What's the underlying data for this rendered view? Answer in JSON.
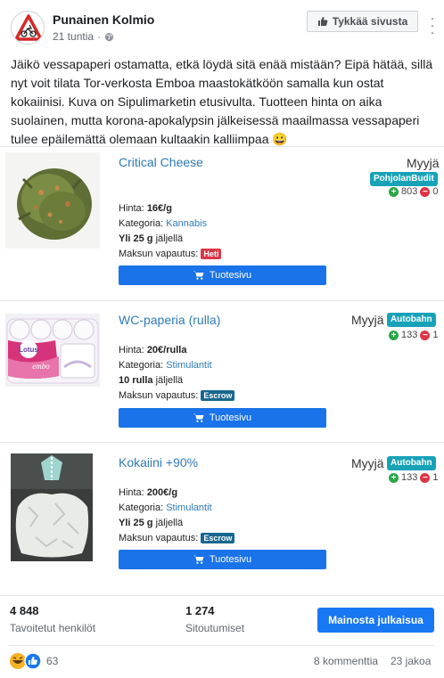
{
  "header": {
    "page_name": "Punainen Kolmio",
    "time": "21 tuntia",
    "like_page_label": "Tykkää sivusta"
  },
  "post": {
    "text": "Jäikö vessapaperi ostamatta, etkä löydä sitä enää mistään? Eipä hätää, sillä nyt voit tilata Tor-verkosta Emboa maastokätköön samalla kun ostat kokaiinisi. Kuva on Sipulimarketin etusivulta. Tuotteen hinta on aika suolainen, mutta korona-apokalypsin jälkeisessä maailmassa vessapaperi tulee epäilemättä olemaan kultaakin kalliimpaa 😀"
  },
  "labels": {
    "price": "Hinta:",
    "category": "Kategoria:",
    "remaining": "jäljellä",
    "payment": "Maksun vapautus:",
    "seller": "Myyjä",
    "product_page": "Tuotesivu"
  },
  "products": [
    {
      "title": "Critical Cheese",
      "seller_badge": "PohjolanBudit",
      "pos": "803",
      "neg": "0",
      "price": "16€/g",
      "category": "Kannabis",
      "stock": "Yli 25 g",
      "payment_badge": "Heti"
    },
    {
      "title": "WC-paperia (rulla)",
      "seller_badge": "Autobahn",
      "pos": "133",
      "neg": "1",
      "price": "20€/rulla",
      "category": "Stimulantit",
      "stock": "10 rulla",
      "payment_badge": "Escrow",
      "image_text": "Lotus embo"
    },
    {
      "title": "Kokaiini +90%",
      "seller_badge": "Autobahn",
      "pos": "133",
      "neg": "1",
      "price": "200€/g",
      "category": "Stimulantit",
      "stock": "Yli 25 g",
      "payment_badge": "Escrow"
    }
  ],
  "stats": {
    "reach_num": "4 848",
    "reach_label": "Tavoitetut henkilöt",
    "engage_num": "1 274",
    "engage_label": "Sitoutumiset",
    "promote_label": "Mainosta julkaisua"
  },
  "footer": {
    "reactions": "63",
    "comments": "8 kommenttia",
    "shares": "23 jakoa"
  },
  "colors": {
    "link": "#2e7ab8",
    "button": "#1a73e8",
    "seller_badge": "#17a2b8",
    "pay_now": "#dc3545",
    "escrow": "#17668f"
  }
}
